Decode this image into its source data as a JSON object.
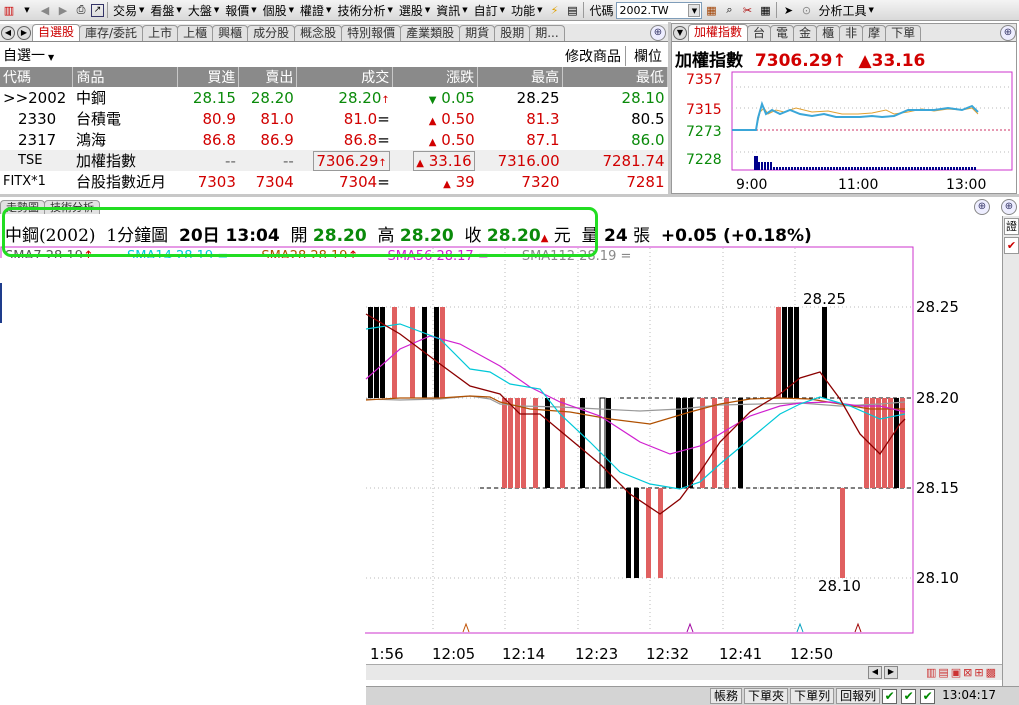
{
  "toolbar": {
    "menus": [
      "交易",
      "看盤",
      "大盤",
      "報價",
      "個股",
      "權證",
      "技術分析",
      "選股",
      "資訊",
      "自訂",
      "功能"
    ],
    "code_label": "代碼",
    "code_value": "2002.TW",
    "analysis_tools": "分析工具"
  },
  "watchlist": {
    "tabs": [
      "自選股",
      "庫存/委託",
      "上市",
      "上櫃",
      "興櫃",
      "成分股",
      "概念股",
      "特別報價",
      "產業類股",
      "期貨",
      "股期",
      "期..."
    ],
    "group": "自選一",
    "modify": "修改商品",
    "fields": "欄位",
    "columns": [
      "代碼",
      "商品",
      "買進",
      "賣出",
      "成交",
      "漲跌",
      "最高",
      "最低"
    ],
    "rows": [
      {
        "code": ">>2002",
        "name": "中鋼",
        "bid": "28.15",
        "ask": "28.20",
        "last": "28.20",
        "last_mark": "↑",
        "chg_mark": "▼",
        "chg": "0.05",
        "high": "28.25",
        "low": "28.10"
      },
      {
        "code": "2330",
        "name": "台積電",
        "bid": "80.9",
        "ask": "81.0",
        "last": "81.0",
        "last_mark": "=",
        "chg_mark": "▲",
        "chg": "0.50",
        "high": "81.3",
        "low": "80.5"
      },
      {
        "code": "2317",
        "name": "鴻海",
        "bid": "86.8",
        "ask": "86.9",
        "last": "86.8",
        "last_mark": "=",
        "chg_mark": "▲",
        "chg": "0.50",
        "high": "87.1",
        "low": "86.0"
      },
      {
        "code": "TSE",
        "name": "加權指數",
        "bid": "--",
        "ask": "--",
        "last": "7306.29",
        "last_mark": "↑",
        "chg_mark": "▲",
        "chg": "33.16",
        "high": "7316.00",
        "low": "7281.74"
      },
      {
        "code": "FITX*1",
        "name": "台股指數近月",
        "bid": "7303",
        "ask": "7304",
        "last": "7304",
        "last_mark": "=",
        "chg_mark": "▲",
        "chg": "39",
        "high": "7320",
        "low": "7281"
      }
    ]
  },
  "index_panel": {
    "tabs": [
      "加權指數",
      "台",
      "電",
      "金",
      "櫃",
      "非",
      "摩",
      "下單"
    ],
    "name": "加權指數",
    "value": "7306.29",
    "value_mark": "↑",
    "change_mark": "▲",
    "change": "33.16",
    "y_ticks": [
      "7357",
      "7315",
      "7273",
      "7228"
    ],
    "x_ticks": [
      "9:00",
      "11:00",
      "13:00"
    ]
  },
  "chart_tabs": [
    "走勢圖",
    "技術分析"
  ],
  "chart_header": {
    "stock": "中鋼(2002)",
    "period": "1分鐘圖",
    "datetime": "20日 13:04",
    "open_label": "開",
    "open": "28.20",
    "high_label": "高",
    "high": "28.20",
    "close_label": "收",
    "close": "28.20",
    "close_mark": "▲",
    "unit": "元",
    "volume_label": "量",
    "volume": "24",
    "volume_unit": "張",
    "change": "+0.05 (+0.18%)"
  },
  "sma": [
    {
      "label": "SMA7 28.19",
      "mark": "↑",
      "color": "#d10000"
    },
    {
      "label": "SMA14 28.19",
      "mark": "=",
      "color": "#00c8d8"
    },
    {
      "label": "SMA28 28.19",
      "mark": "↑",
      "color": "#b05000"
    },
    {
      "label": "SMA56 28.17",
      "mark": "=",
      "color": "#d020d0"
    },
    {
      "label": "SMA112 28.19",
      "mark": "=",
      "color": "#888888"
    }
  ],
  "chart_data": {
    "type": "line",
    "y_ticks": [
      "28.25",
      "28.20",
      "28.15",
      "28.10"
    ],
    "x_ticks": [
      "1:56",
      "12:05",
      "12:14",
      "12:23",
      "12:32",
      "12:41",
      "12:50"
    ],
    "high_label": "28.25",
    "low_label": "28.10",
    "ylim": [
      28.08,
      28.28
    ]
  },
  "statusbar": {
    "buttons": [
      "帳務",
      "下單夾",
      "下單列",
      "回報列"
    ],
    "time": "13:04:17"
  },
  "side_buttons": [
    "證"
  ],
  "colors": {
    "accent": "#d10000",
    "green": "#0a8a0a",
    "highlight": "#22dd22",
    "chart_border": "#cc33cc"
  }
}
